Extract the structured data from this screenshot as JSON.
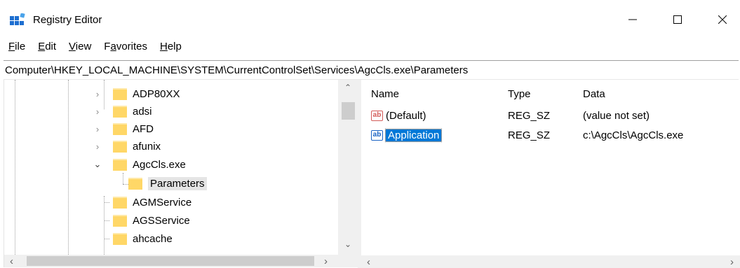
{
  "window": {
    "title": "Registry Editor"
  },
  "menu": [
    {
      "label": "File",
      "underline": "F",
      "rest": "ile"
    },
    {
      "label": "Edit",
      "underline": "E",
      "rest": "dit"
    },
    {
      "label": "View",
      "underline": "V",
      "rest": "iew"
    },
    {
      "label": "Favorites",
      "underline": "a",
      "pre": "F",
      "rest": "vorites"
    },
    {
      "label": "Help",
      "underline": "H",
      "rest": "elp"
    }
  ],
  "address": {
    "path": "Computer\\HKEY_LOCAL_MACHINE\\SYSTEM\\CurrentControlSet\\Services\\AgcCls.exe\\Parameters"
  },
  "tree": {
    "nodes": [
      {
        "label": "ADP80XX",
        "state": "collapsed"
      },
      {
        "label": "adsi",
        "state": "collapsed"
      },
      {
        "label": "AFD",
        "state": "collapsed"
      },
      {
        "label": "afunix",
        "state": "collapsed"
      },
      {
        "label": "AgcCls.exe",
        "state": "expanded"
      },
      {
        "label": "Parameters",
        "state": "selected"
      },
      {
        "label": "AGMService",
        "state": "leaf"
      },
      {
        "label": "AGSService",
        "state": "leaf"
      },
      {
        "label": "ahcache",
        "state": "leaf"
      }
    ]
  },
  "list": {
    "columns": [
      "Name",
      "Type",
      "Data"
    ],
    "rows": [
      {
        "name": "(Default)",
        "type": "REG_SZ",
        "data": "(value not set)",
        "selected": false
      },
      {
        "name": "Application",
        "type": "REG_SZ",
        "data": "c:\\AgcCls\\AgcCls.exe",
        "selected": true
      }
    ]
  },
  "icons": {
    "app": "registry-editor-icon",
    "folder": "folder-icon",
    "string_value": "reg-string-value-icon"
  },
  "colors": {
    "selection": "#0078d7",
    "folder": "#ffd767"
  }
}
